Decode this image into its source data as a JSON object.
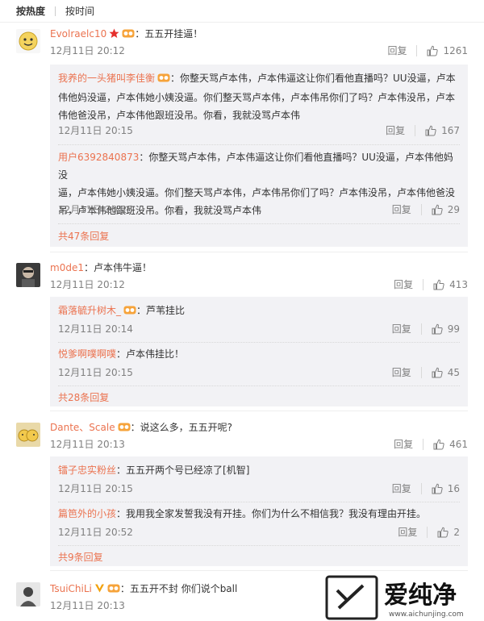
{
  "sort": {
    "hot": "按热度",
    "time": "按时间"
  },
  "reply_label": "回复",
  "threads": [
    {
      "user": "Evolraelc10",
      "text": "：五五开挂逼！",
      "time": "12月11日 20:12",
      "likes": "1261",
      "replies": [
        {
          "user": "我养的一头猪叫李佳衡",
          "text_lines": [
            "：你整天骂卢本伟，卢本伟逼这让你们看他直播吗？UU没逼，卢本",
            "伟他妈没逼，卢本伟她小姨没逼。你们整天骂卢本伟，卢本伟吊你们了吗？卢本伟没吊，卢本",
            "伟他爸没吊，卢本伟他跟班没吊。你看，我就没骂卢本伟"
          ],
          "time": "12月11日 20:15",
          "likes": "167"
        },
        {
          "user": "用户6392840873",
          "text_lines": [
            "：你整天骂卢本伟，卢本伟逼这让你们看他直播吗？UU没逼，卢本伟他妈没",
            "逼，卢本伟她小姨没逼。你们整天骂卢本伟，卢本伟吊你们了吗？卢本伟没吊，卢本伟他爸没",
            "吊，卢本伟他跟班没吊。你看，我就没骂卢本伟"
          ],
          "time": "12月11日 20:25",
          "likes": "29"
        }
      ],
      "more": "共47条回复"
    },
    {
      "user": "m0de1",
      "text": "：卢本伟牛逼！",
      "time": "12月11日 20:12",
      "likes": "413",
      "replies": [
        {
          "user": "霜落毓升树木_",
          "text_lines": [
            "：芦苇挂比"
          ],
          "time": "12月11日 20:14",
          "likes": "99"
        },
        {
          "user": "悦爹啊噗啊噗",
          "text_lines": [
            "：卢本伟挂比！"
          ],
          "time": "12月11日 20:15",
          "likes": "45"
        }
      ],
      "more": "共28条回复"
    },
    {
      "user": "Dante、Scale",
      "text": "：说这么多，五五开呢?",
      "time": "12月11日 20:13",
      "likes": "461",
      "replies": [
        {
          "user": "镭子忠实粉丝",
          "text_lines": [
            "：五五开两个号已经凉了[机智]"
          ],
          "time": "12月11日 20:15",
          "likes": "16"
        },
        {
          "user": "篇笆外的小孩",
          "text_lines": [
            "：我用我全家发誓我没有开挂。你们为什么不相信我？我没有理由开挂。"
          ],
          "time": "12月11日 20:52",
          "likes": "2"
        }
      ],
      "more": "共9条回复"
    },
    {
      "user": "TsuiChiLi",
      "text": "：五五开不封 你们说个ball",
      "time": "12月11日 20:13"
    }
  ],
  "watermark": {
    "brand": "爱纯净",
    "url": "www.aichunjing.com"
  },
  "colors": {
    "username": "#eb7350",
    "subbox": "#f2f2f5",
    "time": "#808080"
  }
}
